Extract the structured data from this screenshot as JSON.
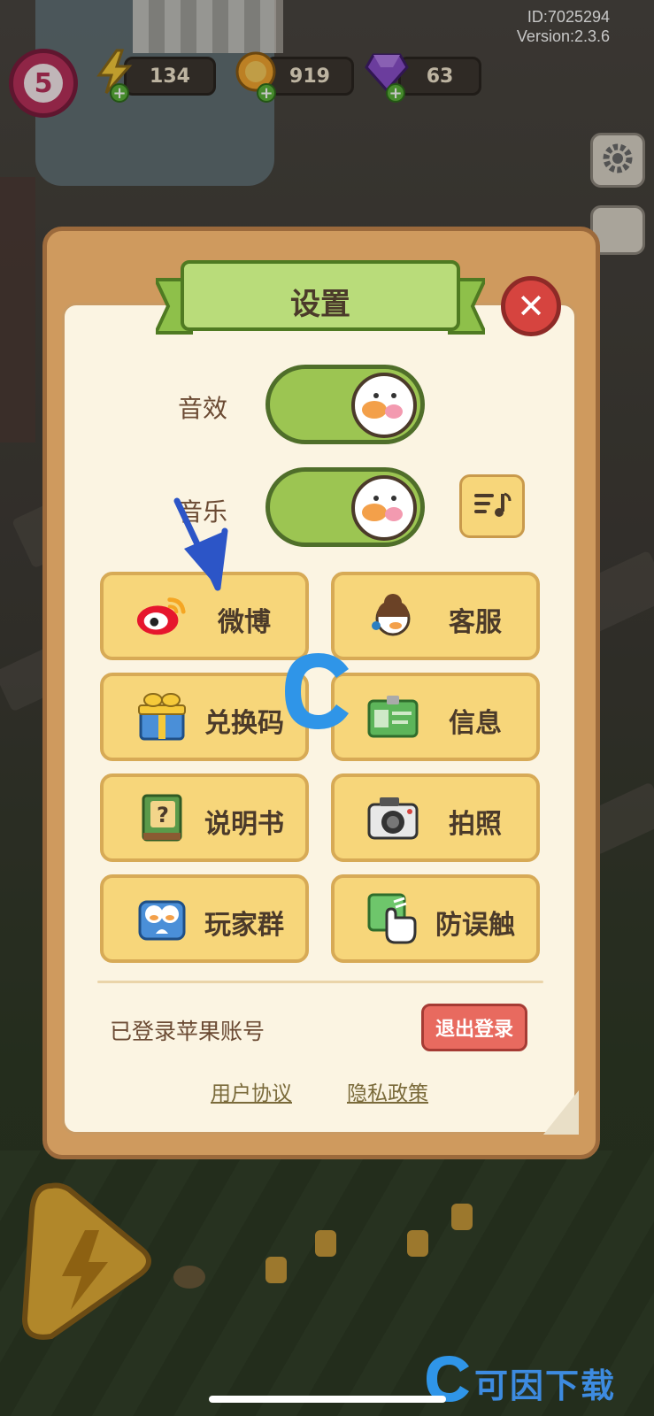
{
  "hud": {
    "level": "5",
    "energy": "134",
    "coins": "919",
    "gems": "63",
    "id_text": "ID:7025294",
    "version_text": "Version:2.3.6"
  },
  "settings": {
    "title": "设置",
    "sound_effects_label": "音效",
    "music_label": "音乐",
    "buttons": [
      {
        "label": "微博",
        "icon": "weibo-icon"
      },
      {
        "label": "客服",
        "icon": "customer-service-icon"
      },
      {
        "label": "兑换码",
        "icon": "gift-icon"
      },
      {
        "label": "信息",
        "icon": "id-card-icon"
      },
      {
        "label": "说明书",
        "icon": "manual-icon"
      },
      {
        "label": "拍照",
        "icon": "camera-icon"
      },
      {
        "label": "玩家群",
        "icon": "player-group-icon"
      },
      {
        "label": "防误触",
        "icon": "touch-guard-icon"
      }
    ],
    "login_status": "已登录苹果账号",
    "logout_label": "退出登录",
    "user_agreement": "用户协议",
    "privacy_policy": "隐私政策"
  },
  "watermark": {
    "site_name": "可因下载"
  },
  "colors": {
    "toggle_on": "#9cc552",
    "button_fill": "#f7d67a",
    "panel_frame": "#cf9a5e",
    "close_red": "#d6443f",
    "logout_red": "#e86a5f"
  }
}
